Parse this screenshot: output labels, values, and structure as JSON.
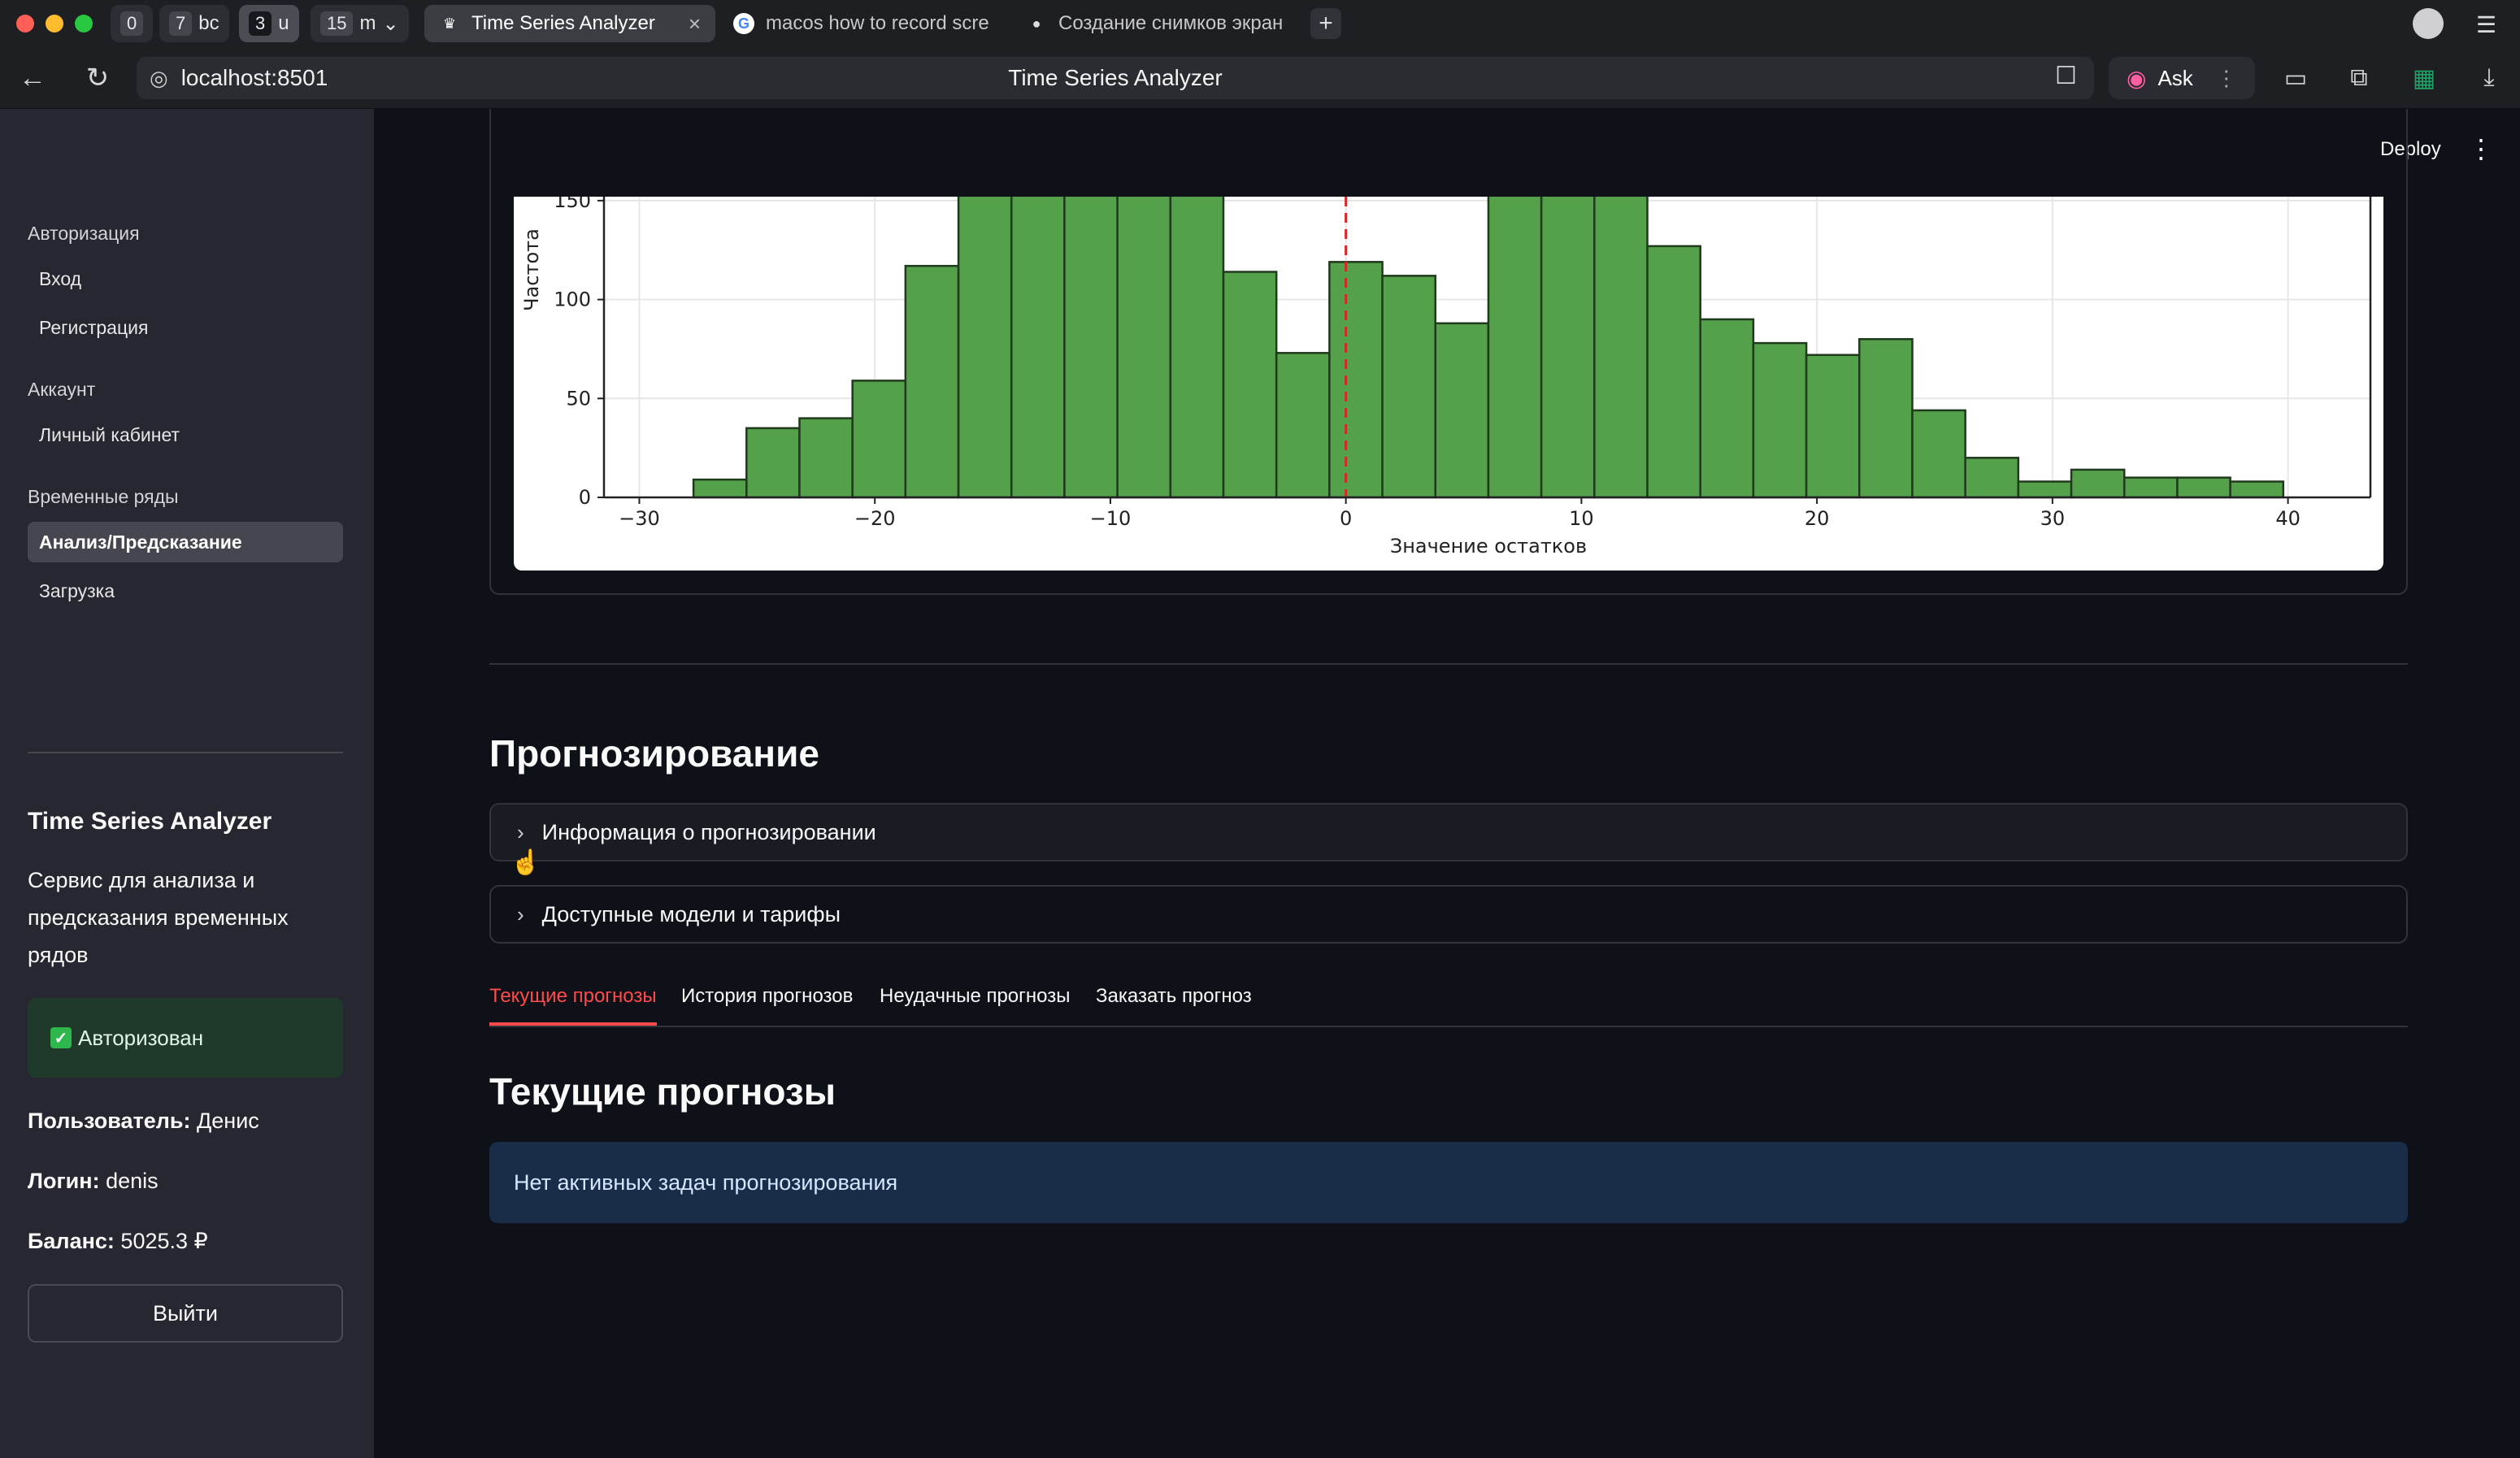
{
  "browser": {
    "tab_groups": [
      {
        "num": "0",
        "label": ""
      },
      {
        "num": "7",
        "label": "bc"
      },
      {
        "num": "3",
        "label": "u"
      },
      {
        "num": "15",
        "label": "m"
      }
    ],
    "tabs": [
      {
        "title": "Time Series Analyzer",
        "icon": "streamlit-crown-icon"
      },
      {
        "title": "macos how to record scre",
        "icon": "google-icon"
      },
      {
        "title": "Создание снимков экран",
        "icon": "apple-icon"
      }
    ],
    "url": "localhost:8501",
    "page_title": "Time Series Analyzer",
    "ask_label": "Ask"
  },
  "sidebar": {
    "sections": [
      {
        "title": "Авторизация",
        "items": [
          "Вход",
          "Регистрация"
        ]
      },
      {
        "title": "Аккаунт",
        "items": [
          "Личный кабинет"
        ]
      },
      {
        "title": "Временные ряды",
        "items": [
          "Анализ/Предсказание",
          "Загрузка"
        ]
      }
    ],
    "app_title": "Time Series Analyzer",
    "app_description": "Сервис для анализа и предсказания временных рядов",
    "auth_status": "Авторизован",
    "user_label": "Пользователь:",
    "user_value": "Денис",
    "login_label": "Логин:",
    "login_value": "denis",
    "balance_label": "Баланс:",
    "balance_value": "5025.3 ₽",
    "logout_label": "Выйти"
  },
  "header": {
    "deploy_label": "Deploy"
  },
  "main": {
    "section_title": "Прогнозирование",
    "expanders": [
      "Информация о прогнозировании",
      "Доступные модели и тарифы"
    ],
    "tabs": [
      "Текущие прогнозы",
      "История прогнозов",
      "Неудачные прогнозы",
      "Заказать прогноз"
    ],
    "active_tab": "Текущие прогнозы",
    "subsection_title": "Текущие прогнозы",
    "info_message": "Нет активных задач прогнозирования"
  },
  "chart_data": {
    "type": "bar",
    "xlabel": "Значение остатков",
    "ylabel": "Частота",
    "bin_width": 2.25,
    "bins_start": [
      -27.7,
      -25.45,
      -23.2,
      -20.95,
      -18.7,
      -16.45,
      -14.2,
      -11.95,
      -9.7,
      -7.45,
      -5.2,
      -2.95,
      -0.7,
      1.55,
      3.8,
      6.05,
      8.3,
      10.55,
      12.8,
      15.05,
      17.3,
      19.55,
      21.8,
      24.05,
      26.3,
      28.55,
      30.8,
      33.05,
      35.3,
      37.55
    ],
    "values": [
      9,
      35,
      40,
      59,
      117,
      160,
      160,
      160,
      160,
      160,
      114,
      73,
      119,
      112,
      88,
      160,
      160,
      160,
      127,
      90,
      78,
      72,
      80,
      44,
      20,
      8,
      14,
      10,
      10,
      8
    ],
    "xticks": [
      -30,
      -20,
      -10,
      0,
      10,
      20,
      30,
      40
    ],
    "yticks": [
      0,
      50,
      100,
      150
    ],
    "xlim": [
      -31.5,
      43.5
    ],
    "visible_ylim": [
      0,
      152
    ],
    "vline_x": 0,
    "bar_color": "#55a04a",
    "vline_color": "#d62728",
    "grid": true
  }
}
